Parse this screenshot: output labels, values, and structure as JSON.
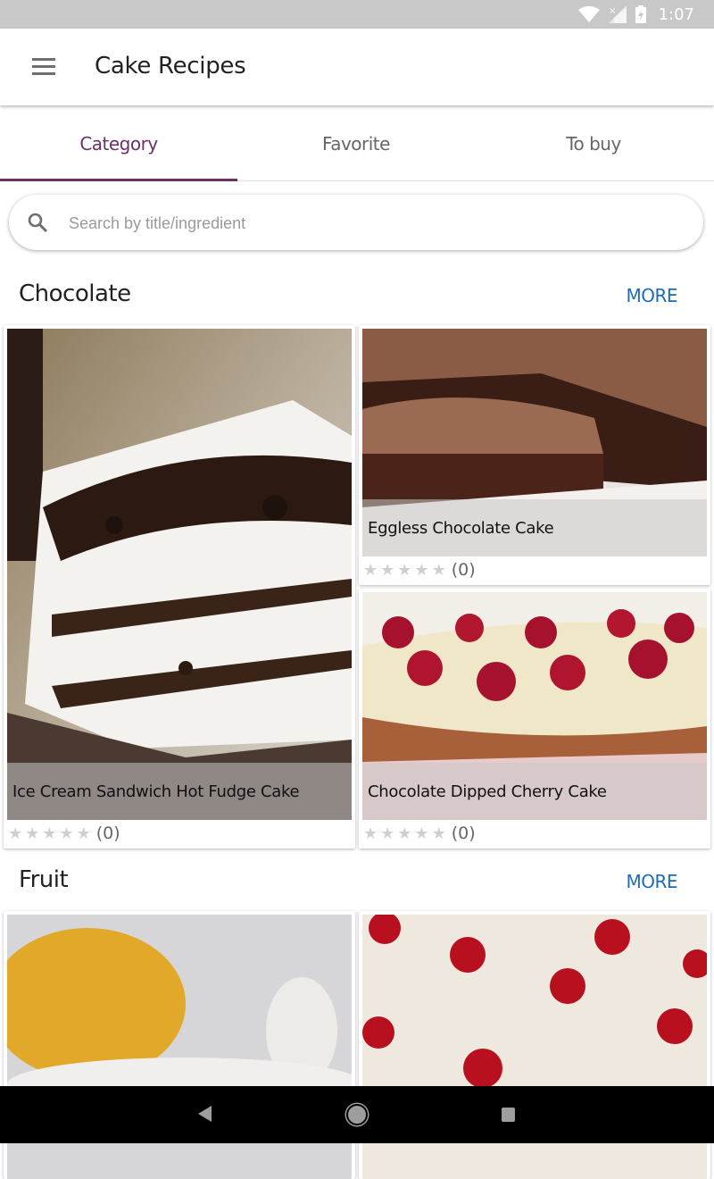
{
  "status_bar": {
    "time": "1:07",
    "icons": [
      "wifi-icon",
      "signal-off-icon",
      "battery-charging-icon"
    ]
  },
  "app_bar": {
    "title": "Cake Recipes",
    "menu_icon": "hamburger-menu-icon"
  },
  "tabs": [
    {
      "label": "Category",
      "active": true
    },
    {
      "label": "Favorite",
      "active": false
    },
    {
      "label": "To buy",
      "active": false
    }
  ],
  "search": {
    "placeholder": "Search by title/ingredient",
    "value": "",
    "icon": "search-icon"
  },
  "sections": [
    {
      "title": "Chocolate",
      "more_label": "MORE",
      "recipes": [
        {
          "title": "Ice Cream Sandwich Hot Fudge Cake",
          "rating": 0,
          "max_rating": 5,
          "rating_count": "(0)"
        },
        {
          "title": "Eggless Chocolate Cake",
          "rating": 0,
          "max_rating": 5,
          "rating_count": "(0)"
        },
        {
          "title": "Chocolate Dipped Cherry Cake",
          "rating": 0,
          "max_rating": 5,
          "rating_count": "(0)"
        }
      ]
    },
    {
      "title": "Fruit",
      "more_label": "MORE",
      "recipes": [
        {
          "title": "",
          "rating": 0,
          "max_rating": 5,
          "rating_count": ""
        },
        {
          "title": "",
          "rating": 0,
          "max_rating": 5,
          "rating_count": ""
        }
      ]
    }
  ],
  "colors": {
    "accent": "#6b3160",
    "link": "#1e6bb8",
    "star_empty": "#cfcfcf"
  },
  "nav_bar": {
    "buttons": [
      "back-icon",
      "home-icon",
      "recents-icon"
    ]
  }
}
